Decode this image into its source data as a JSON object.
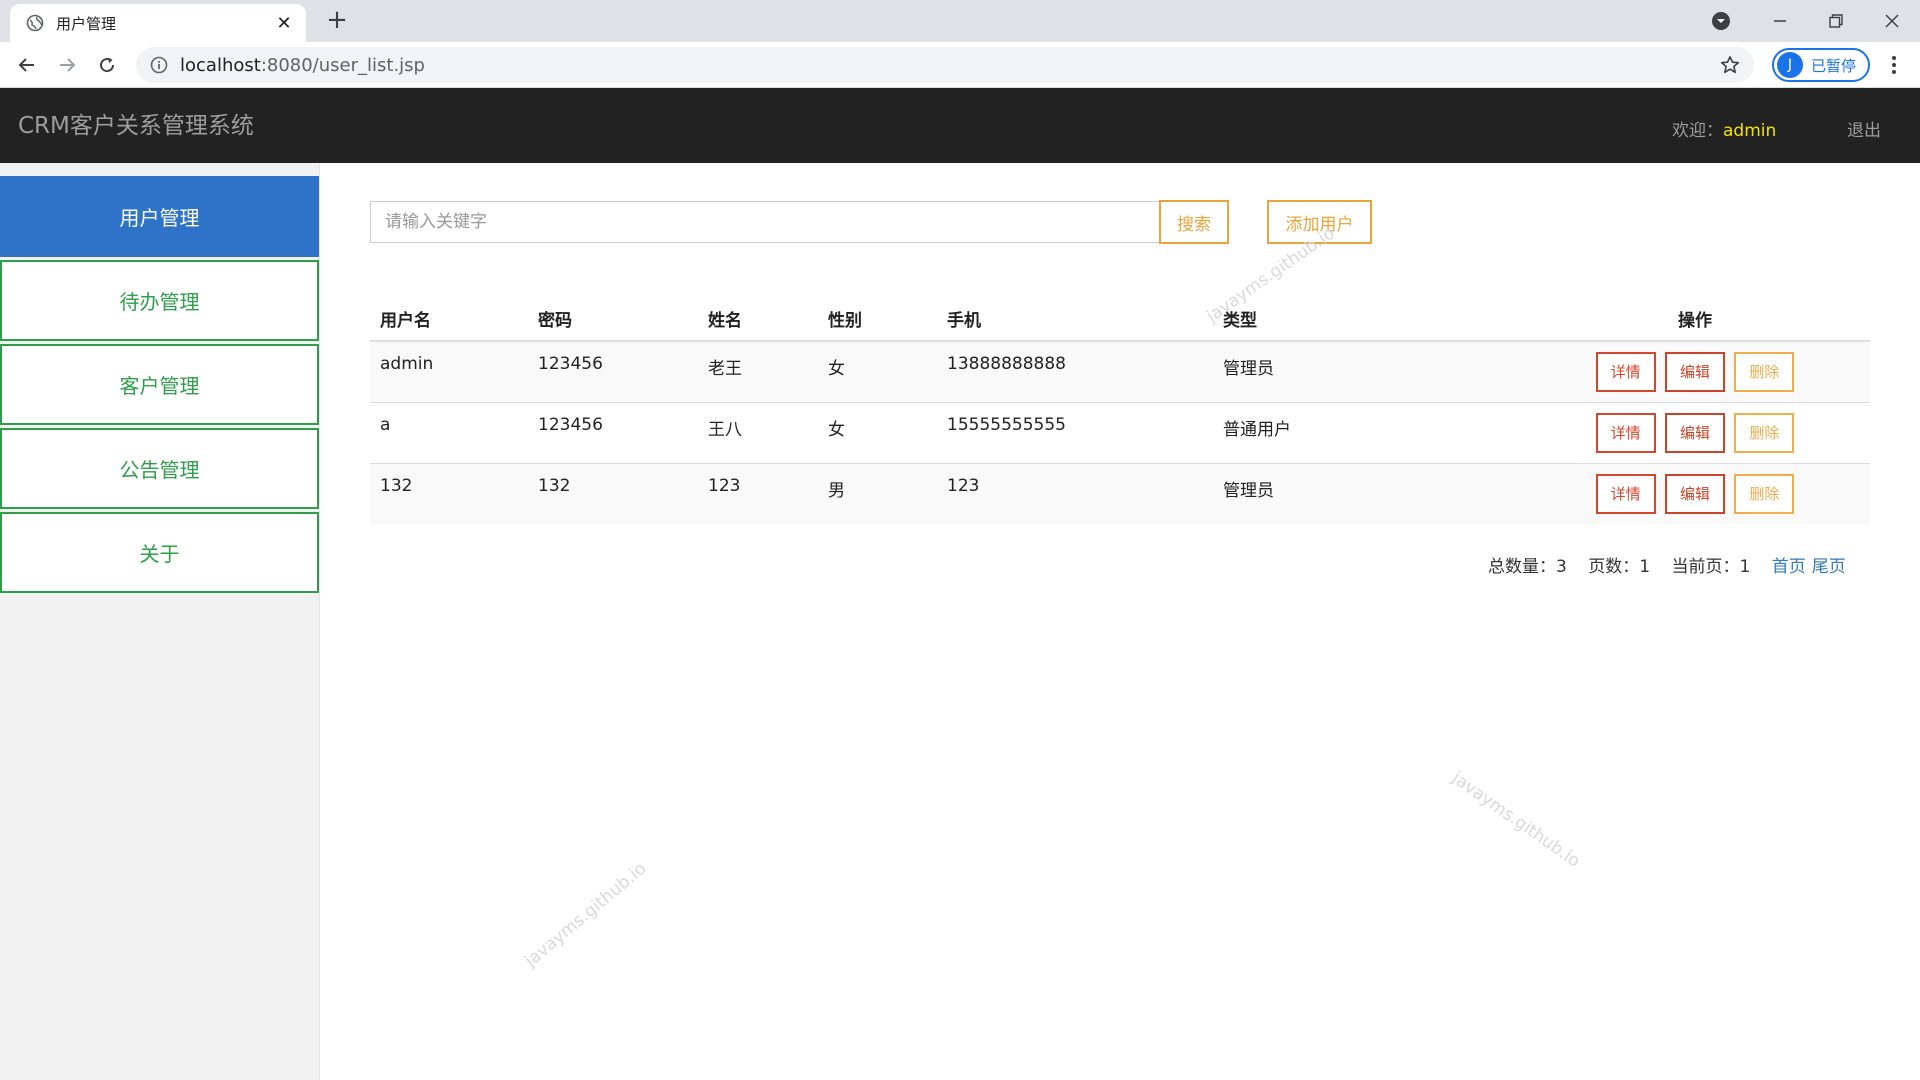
{
  "browser": {
    "tab_title": "用户管理",
    "url_host": "localhost",
    "url_path": ":8080/user_list.jsp",
    "profile_initial": "J",
    "profile_status": "已暂停"
  },
  "header": {
    "brand": "CRM客户关系管理系统",
    "welcome_label": "欢迎：",
    "username": "admin",
    "logout": "退出"
  },
  "sidebar": {
    "items": [
      {
        "label": "用户管理"
      },
      {
        "label": "待办管理"
      },
      {
        "label": "客户管理"
      },
      {
        "label": "公告管理"
      },
      {
        "label": "关于"
      }
    ]
  },
  "search": {
    "placeholder": "请输入关键字",
    "search_label": "搜索",
    "add_label": "添加用户"
  },
  "table": {
    "columns": [
      "用户名",
      "密码",
      "姓名",
      "性别",
      "手机",
      "类型",
      "操作"
    ],
    "rows": [
      {
        "username": "admin",
        "password": "123456",
        "name": "老王",
        "gender": "女",
        "phone": "13888888888",
        "type": "管理员"
      },
      {
        "username": "a",
        "password": "123456",
        "name": "王八",
        "gender": "女",
        "phone": "15555555555",
        "type": "普通用户"
      },
      {
        "username": "132",
        "password": "132",
        "name": "123",
        "gender": "男",
        "phone": "123",
        "type": "管理员"
      }
    ],
    "actions": {
      "detail": "详情",
      "edit": "编辑",
      "delete": "删除"
    }
  },
  "pagination": {
    "total": "总数量：3",
    "pages": "页数：1",
    "current": "当前页：1",
    "first": "首页",
    "last": "尾页"
  },
  "watermark": "javayms.github.io"
}
